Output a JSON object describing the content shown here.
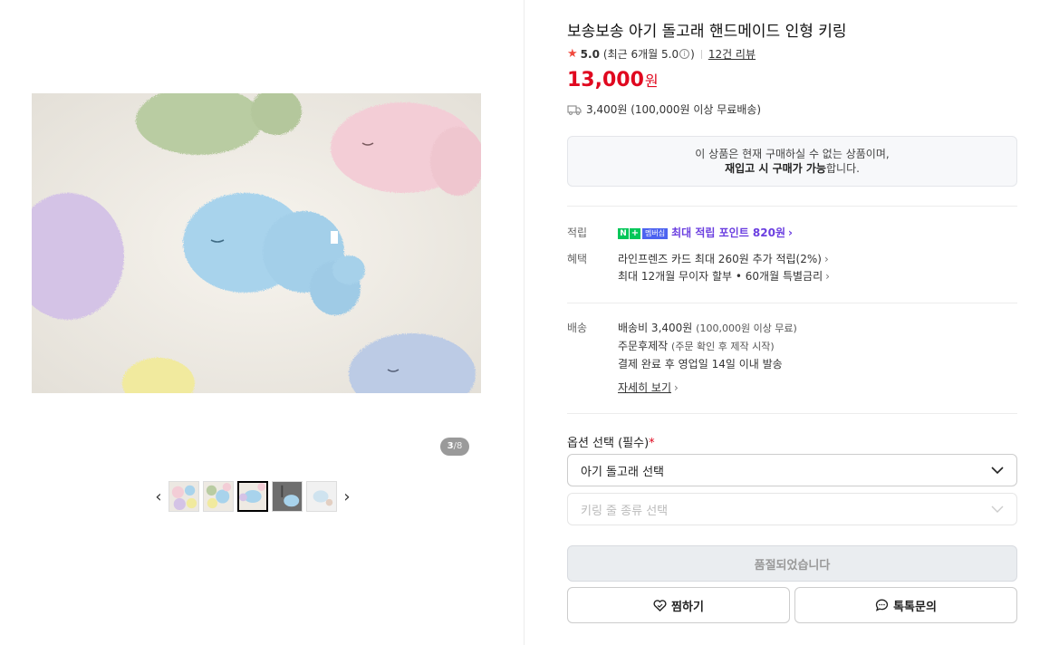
{
  "gallery": {
    "counter_current": "3",
    "counter_total": "/8",
    "prev_label": "‹",
    "next_label": "›"
  },
  "product": {
    "title": "보송보송 아기 돌고래 핸드메이드 인형 키링",
    "rating_score": "5.0",
    "rating_recent": "(최근 6개월 5.0",
    "rating_recent_close": ")",
    "review_link": "12건 리뷰",
    "price": "13,000",
    "price_unit": "원",
    "shipping_summary": "3,400원 (100,000원 이상 무료배송)"
  },
  "notice": {
    "line1": "이 상품은 현재 구매하실 수 없는 상품이며,",
    "line2_bold": "재입고 시 구매가 가능",
    "line2_rest": "합니다."
  },
  "benefits": {
    "points_label": "적립",
    "npay_n": "N",
    "npay_plus": "+",
    "npay_member": "멤버십",
    "points_link": "최대 적립 포인트 820원",
    "benefit_label": "혜택",
    "benefit_line1": "라인프렌즈 카드 최대 260원 추가 적립(2%)",
    "benefit_line2": "최대 12개월 무이자 할부 • 60개월 특별금리"
  },
  "delivery": {
    "label": "배송",
    "fee": "배송비 3,400원",
    "fee_note": "(100,000원 이상 무료)",
    "made_to_order": "주문후제작",
    "made_note": "(주문 확인 후 제작 시작)",
    "dispatch": "결제 완료 후 영업일 14일 이내 발송",
    "detail_link": "자세히 보기"
  },
  "options": {
    "label": "옵션 선택 (필수)",
    "required_mark": "*",
    "select1": "아기 돌고래 선택",
    "select2": "키링 줄 종류 선택"
  },
  "actions": {
    "soldout": "품절되었습니다",
    "wish": "찜하기",
    "talk": "톡톡문의"
  },
  "colors": {
    "price": "#e0081f",
    "points": "#6b3fe0",
    "npay_green": "#03c75a",
    "star": "#f0493e"
  }
}
